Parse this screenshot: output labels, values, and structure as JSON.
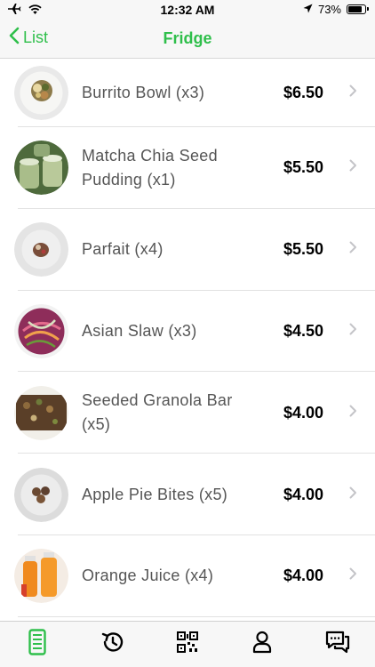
{
  "status_bar": {
    "time": "12:32 AM",
    "battery_percent": "73%",
    "battery_level": 0.73,
    "icons": [
      "airplane-icon",
      "wifi-icon",
      "location-arrow-icon",
      "battery-icon"
    ]
  },
  "nav": {
    "back_label": "List",
    "title": "Fridge",
    "accent_color": "#2fbf4b"
  },
  "items": [
    {
      "name": "Burrito Bowl (x3)",
      "price": "$6.50"
    },
    {
      "name": "Matcha Chia Seed Pudding (x1)",
      "price": "$5.50"
    },
    {
      "name": "Parfait (x4)",
      "price": "$5.50"
    },
    {
      "name": "Asian Slaw (x3)",
      "price": "$4.50"
    },
    {
      "name": "Seeded Granola Bar (x5)",
      "price": "$4.00"
    },
    {
      "name": "Apple Pie Bites (x5)",
      "price": "$4.00"
    },
    {
      "name": "Orange Juice (x4)",
      "price": "$4.00"
    }
  ],
  "tab_bar": {
    "tabs": [
      {
        "icon": "fridge-icon",
        "active": true
      },
      {
        "icon": "history-icon",
        "active": false
      },
      {
        "icon": "qr-code-icon",
        "active": false
      },
      {
        "icon": "profile-icon",
        "active": false
      },
      {
        "icon": "chat-icon",
        "active": false
      }
    ]
  }
}
